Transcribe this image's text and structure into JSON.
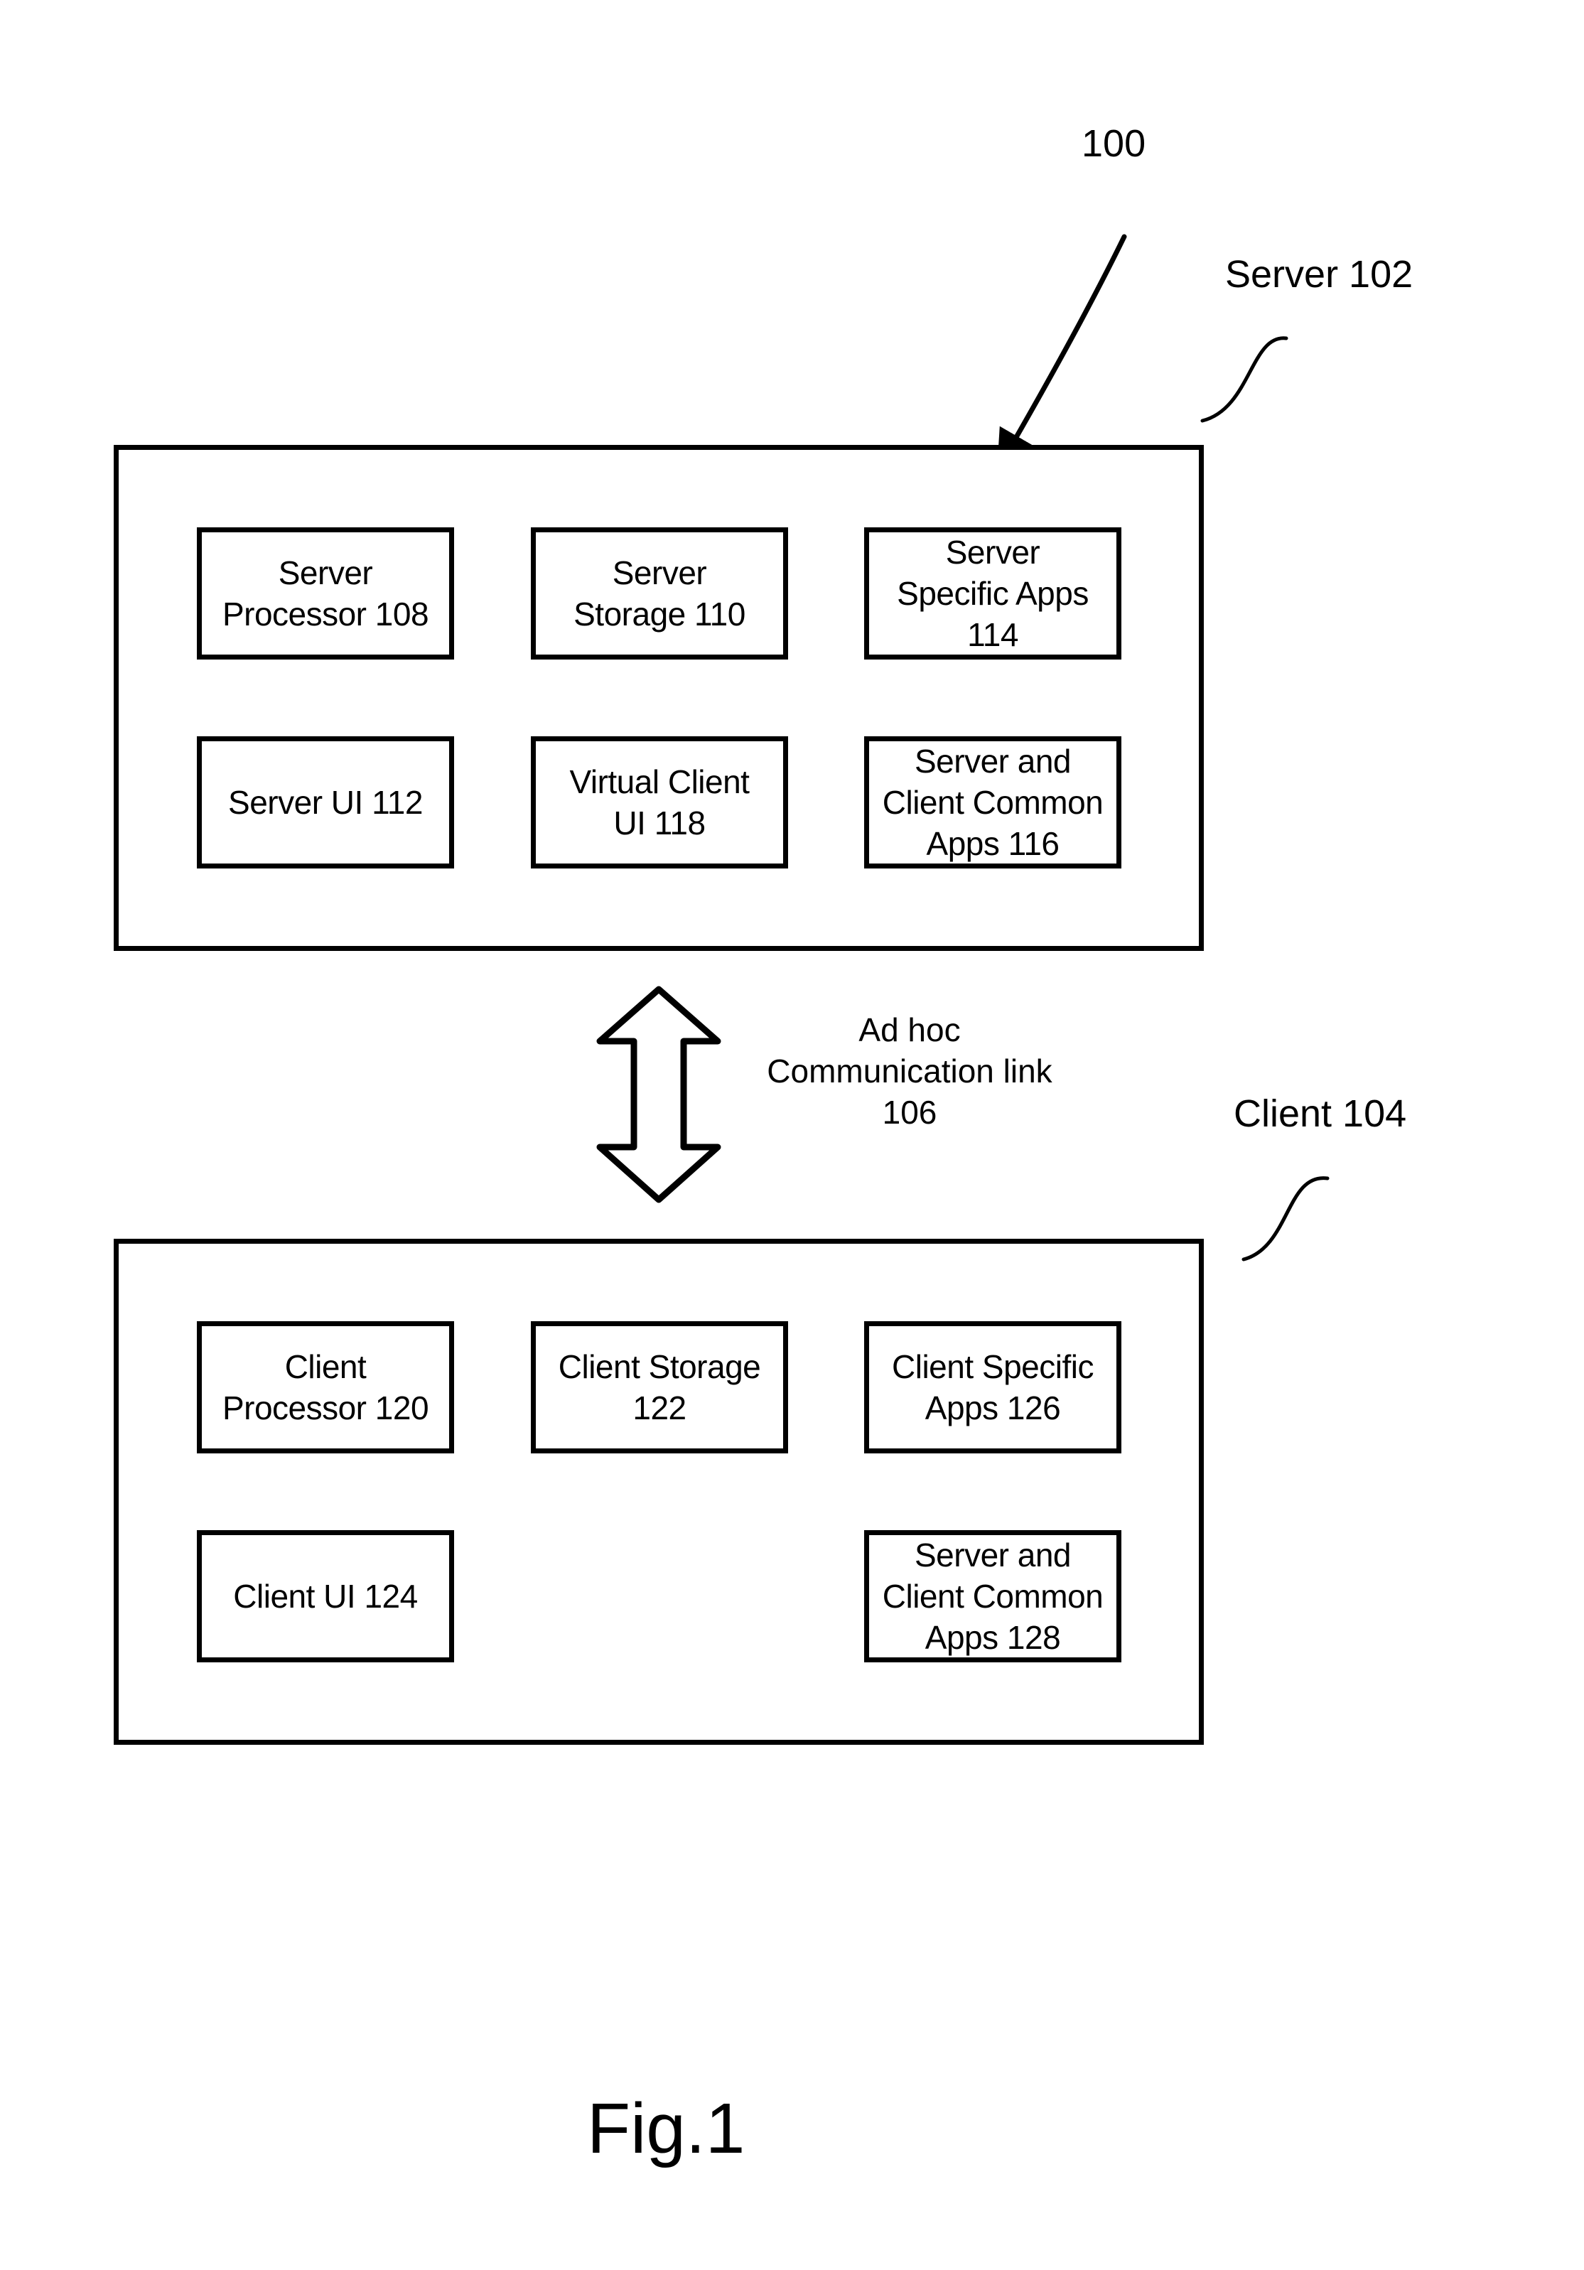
{
  "diagram": {
    "system_label": "100",
    "figure_caption": "Fig.1",
    "server": {
      "label": "Server 102",
      "components": [
        {
          "id": "server-processor",
          "text": "Server\nProcessor 108"
        },
        {
          "id": "server-storage",
          "text": "Server\nStorage 110"
        },
        {
          "id": "server-specific-apps",
          "text": "Server\nSpecific Apps\n114"
        },
        {
          "id": "server-ui",
          "text": "Server UI 112"
        },
        {
          "id": "virtual-client-ui",
          "text": "Virtual Client\nUI 118"
        },
        {
          "id": "server-client-common-apps-116",
          "text": "Server and\nClient Common\nApps 116"
        }
      ]
    },
    "link": {
      "label": "Ad hoc\nCommunication link\n106"
    },
    "client": {
      "label": "Client 104",
      "components": [
        {
          "id": "client-processor",
          "text": "Client\nProcessor 120"
        },
        {
          "id": "client-storage",
          "text": "Client Storage\n122"
        },
        {
          "id": "client-specific-apps",
          "text": "Client Specific\nApps 126"
        },
        {
          "id": "client-ui",
          "text": "Client UI 124"
        },
        {
          "id": "server-client-common-apps-128",
          "text": "Server and\nClient Common\nApps 128"
        }
      ]
    }
  }
}
